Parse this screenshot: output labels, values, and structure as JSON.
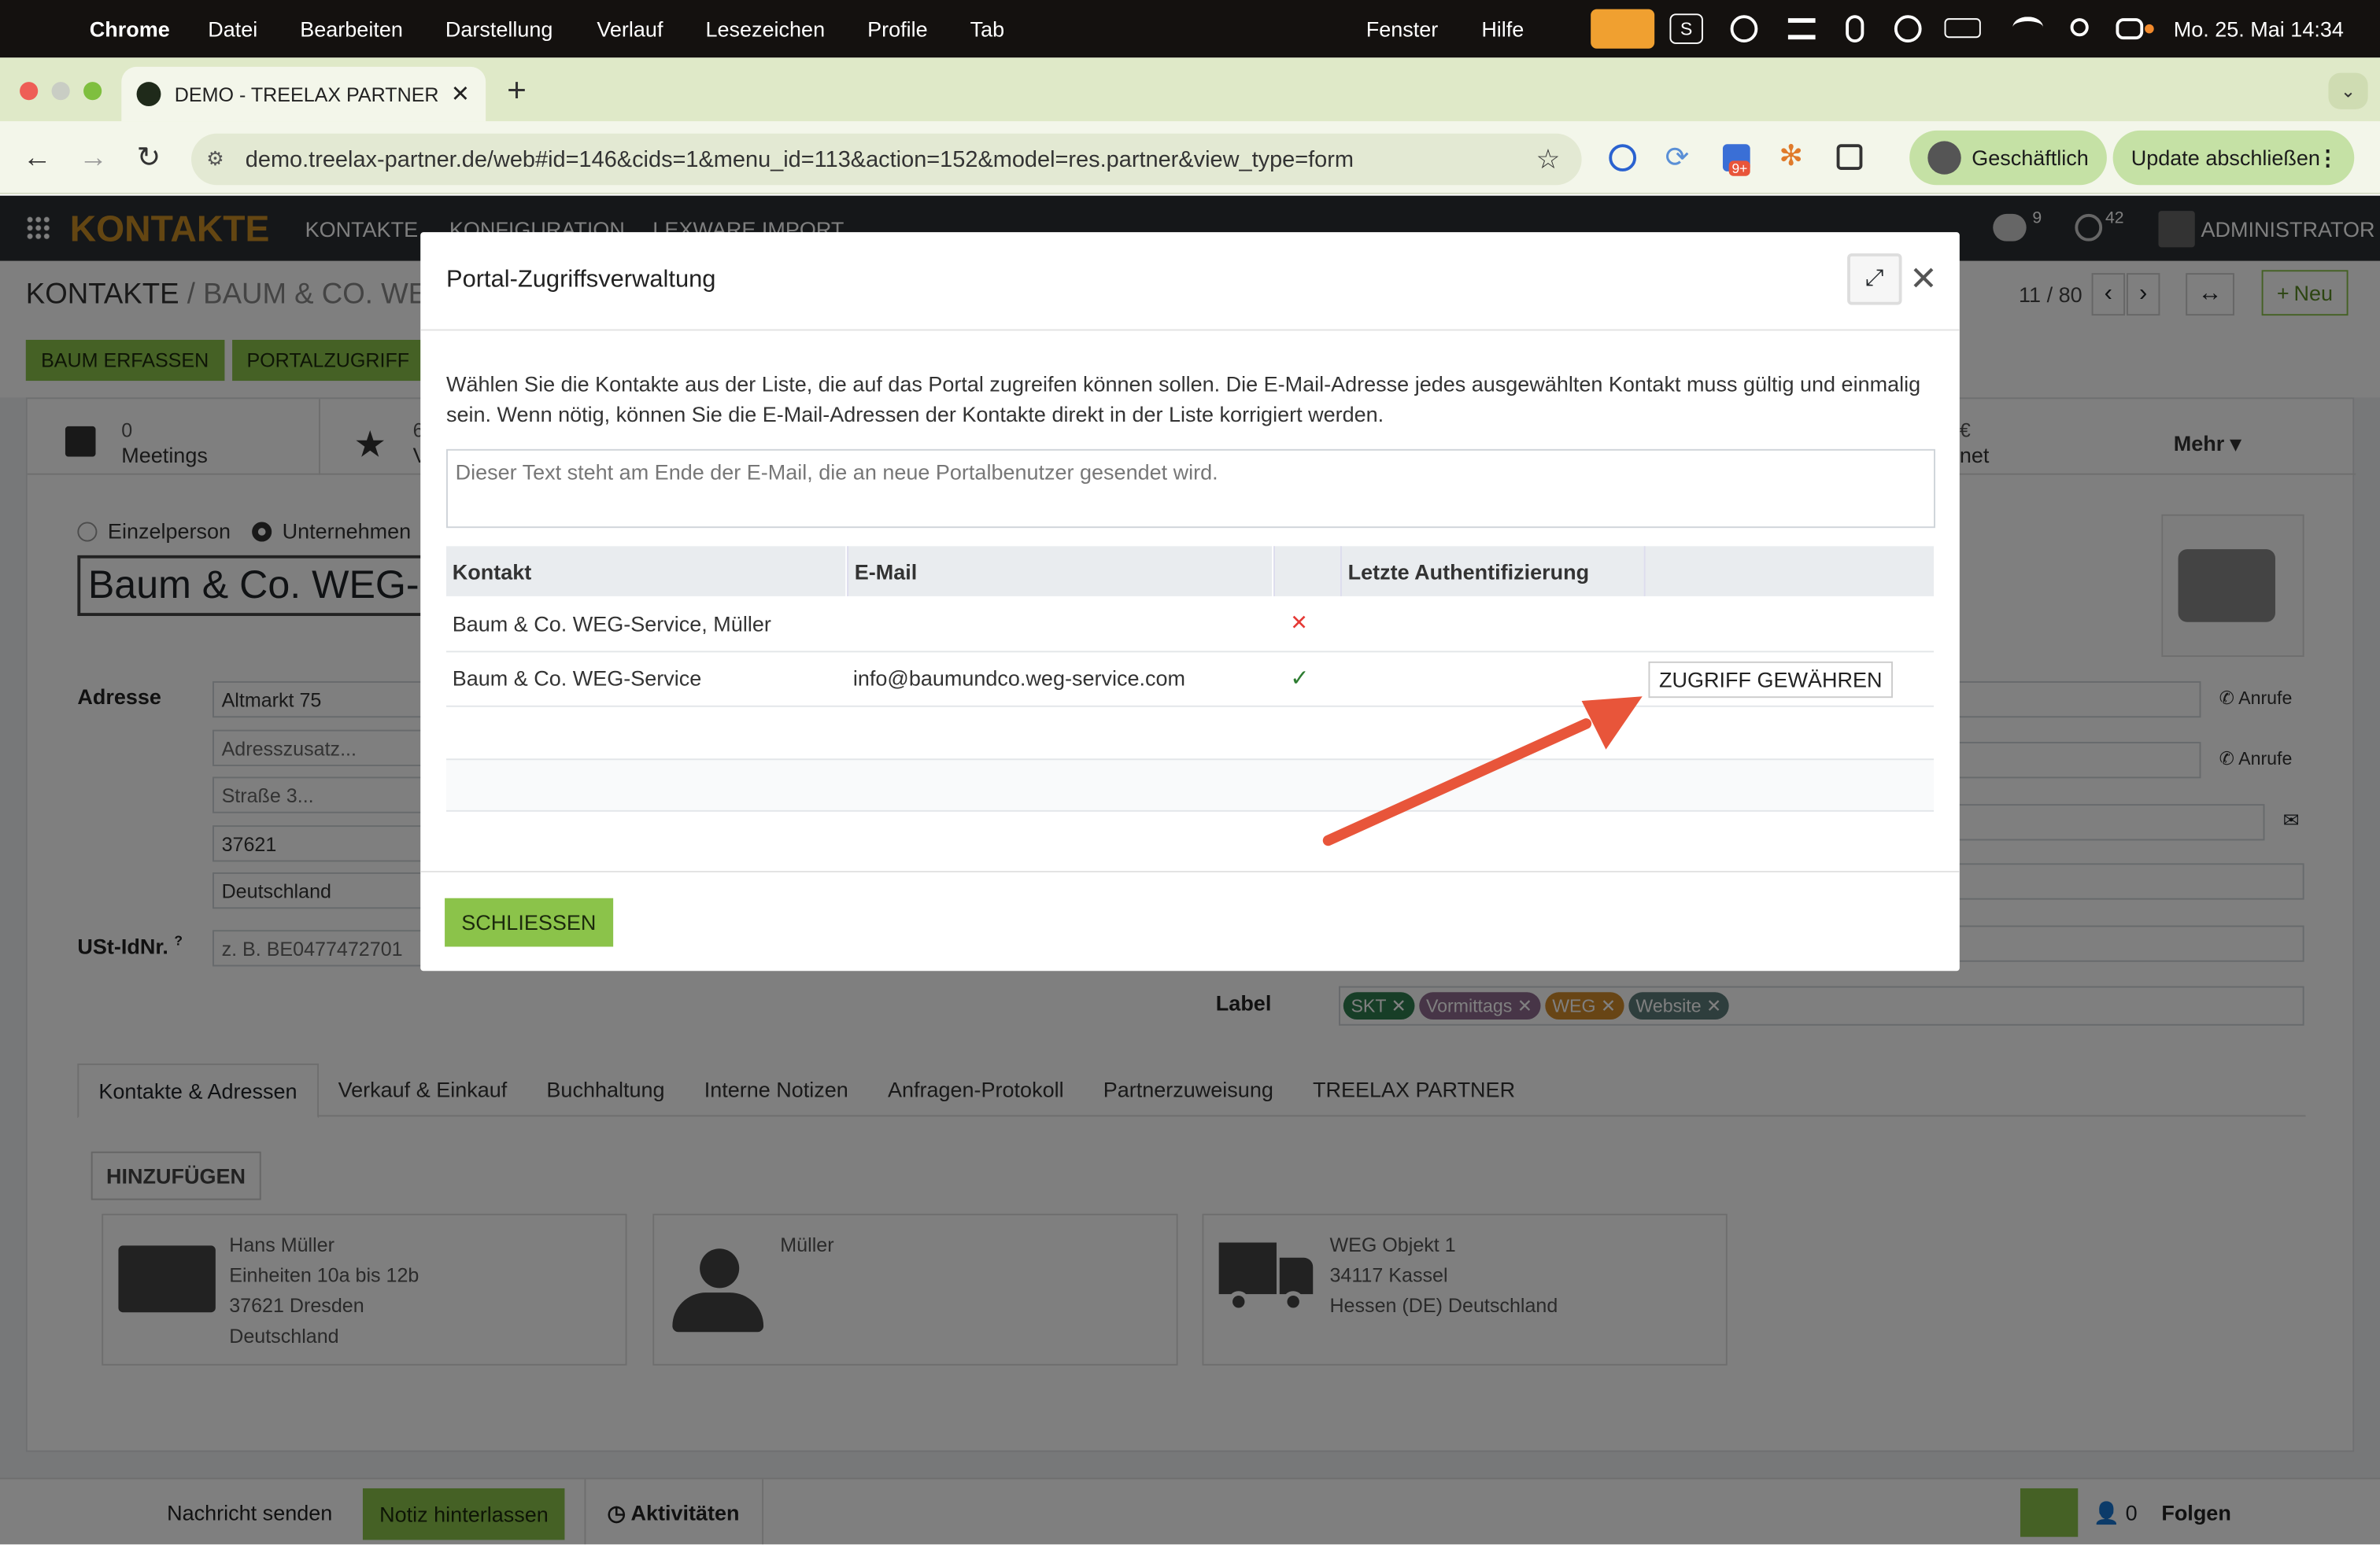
{
  "macos": {
    "app": "Chrome",
    "menus": [
      "Datei",
      "Bearbeiten",
      "Darstellung",
      "Verlauf",
      "Lesezeichen",
      "Profile",
      "Tab"
    ],
    "right_menus": [
      "Fenster",
      "Hilfe"
    ],
    "datetime": "Mo. 25. Mai 14:34"
  },
  "browser": {
    "tab_title": "DEMO - TREELAX PARTNER -",
    "url": "demo.treelax-partner.de/web#id=146&cids=1&menu_id=113&action=152&model=res.partner&view_type=form",
    "profile_label": "Geschäftlich",
    "update_label": "Update abschließen",
    "ext_badge": "9+"
  },
  "odoo": {
    "app_title": "KONTAKTE",
    "menu": [
      "KONTAKTE",
      "KONFIGURATION",
      "LEXWARE IMPORT"
    ],
    "messages_count": "9",
    "activities_count": "42",
    "user": "ADMINISTRATOR",
    "breadcrumb_root": "KONTAKTE",
    "breadcrumb_current": "BAUM & CO. WEG",
    "pager": "11 / 80",
    "new_button": "Neu",
    "action_buttons": [
      "BAUM ERFASSEN",
      "PORTALZUGRIFF"
    ],
    "stat_meetings_count": "0",
    "stat_meetings_label": "Meetings",
    "stat_second_count": "6",
    "stat_second_label": "V",
    "stat_right_frag_top": "€",
    "stat_right_frag_bottom": "net",
    "more_label": "Mehr",
    "type_person": "Einzelperson",
    "type_company": "Unternehmen",
    "name": "Baum & Co. WEG-S",
    "address_label": "Adresse",
    "address": {
      "street": "Altmarkt 75",
      "street2_placeholder": "Adresszusatz...",
      "street3_placeholder": "Straße 3...",
      "zip": "37621",
      "country": "Deutschland"
    },
    "vat_label": "USt-IdNr.",
    "vat_sup": "?",
    "vat_placeholder": "z. B. BE0477472701",
    "call_label": "Anrufe",
    "label_field": "Label",
    "tags": [
      {
        "name": "SKT",
        "color": "#2e7d4f"
      },
      {
        "name": "Vormittags",
        "color": "#8e6b8f"
      },
      {
        "name": "WEG",
        "color": "#d18b2b"
      },
      {
        "name": "Website",
        "color": "#5c7c7a"
      }
    ],
    "tabs": [
      "Kontakte & Adressen",
      "Verkauf & Einkauf",
      "Buchhaltung",
      "Interne Notizen",
      "Anfragen-Protokoll",
      "Partnerzuweisung",
      "TREELAX PARTNER"
    ],
    "add_button": "HINZUFÜGEN",
    "cards": [
      {
        "lines": [
          "Hans Müller",
          "Einheiten 10a bis 12b",
          "37621 Dresden",
          "Deutschland"
        ]
      },
      {
        "lines": [
          "Müller"
        ]
      },
      {
        "lines": [
          "WEG Objekt 1",
          "34117 Kassel",
          "Hessen (DE) Deutschland"
        ]
      }
    ],
    "chatter": {
      "send": "Nachricht senden",
      "note": "Notiz hinterlassen",
      "activities": "Aktivitäten",
      "followers_count": "0",
      "follow": "Folgen"
    }
  },
  "modal": {
    "title": "Portal-Zugriffsverwaltung",
    "description": "Wählen Sie die Kontakte aus der Liste, die auf das Portal zugreifen können sollen. Die E-Mail-Adresse jedes ausgewählten Kontakt muss gültig und einmalig sein. Wenn nötig, können Sie die E-Mail-Adressen der Kontakte direkt in der Liste korrigiert werden.",
    "textarea_placeholder": "Dieser Text steht am Ende der E-Mail, die an neue Portalbenutzer gesendet wird.",
    "columns": [
      "Kontakt",
      "E-Mail",
      "",
      "Letzte Authentifizierung",
      ""
    ],
    "rows": [
      {
        "contact": "Baum & Co. WEG-Service, Müller",
        "email": "",
        "valid": false,
        "last_auth": "",
        "action": ""
      },
      {
        "contact": "Baum & Co. WEG-Service",
        "email": "info@baumundco.weg-service.com",
        "valid": true,
        "last_auth": "",
        "action": "ZUGRIFF GEWÄHREN"
      }
    ],
    "close_button": "SCHLIESSEN"
  },
  "colors": {
    "accent_green": "#8bc34a",
    "odoo_nav": "#2a2f33",
    "arrow": "#e8553a",
    "invalid": "#e53935",
    "valid": "#2e7d32"
  }
}
